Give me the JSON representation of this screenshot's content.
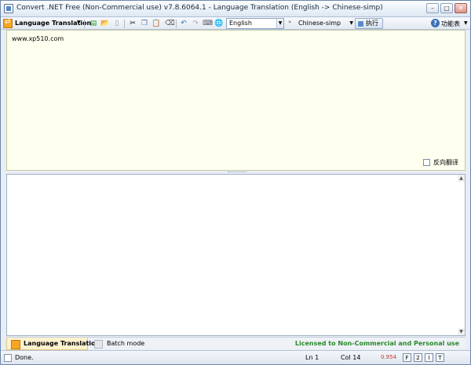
{
  "window": {
    "title": "Convert .NET Free (Non-Commercial use) v7.8.6064.1 - Language Translation (English -> Chinese-simp)",
    "min": "–",
    "max": "□",
    "close": "✕"
  },
  "toolbar": {
    "mode_label": "Language Translation",
    "source_language": "English",
    "arrow": "»",
    "target_language": "Chinese-simp",
    "execute_label": "执行",
    "help_label": "功能表"
  },
  "input": {
    "text": "www.xp510.com",
    "reverse_label": "反向翻译"
  },
  "bottom_tabs": {
    "active_label": "Language Translation",
    "batch_label": "Batch mode",
    "license_text": "Licensed to Non-Commercial and Personal use"
  },
  "status": {
    "done": "Done.",
    "line": "Ln 1",
    "column": "Col 14",
    "count": "0.954",
    "box1": "F",
    "box2": "2",
    "box3": "I",
    "box4": "T"
  }
}
